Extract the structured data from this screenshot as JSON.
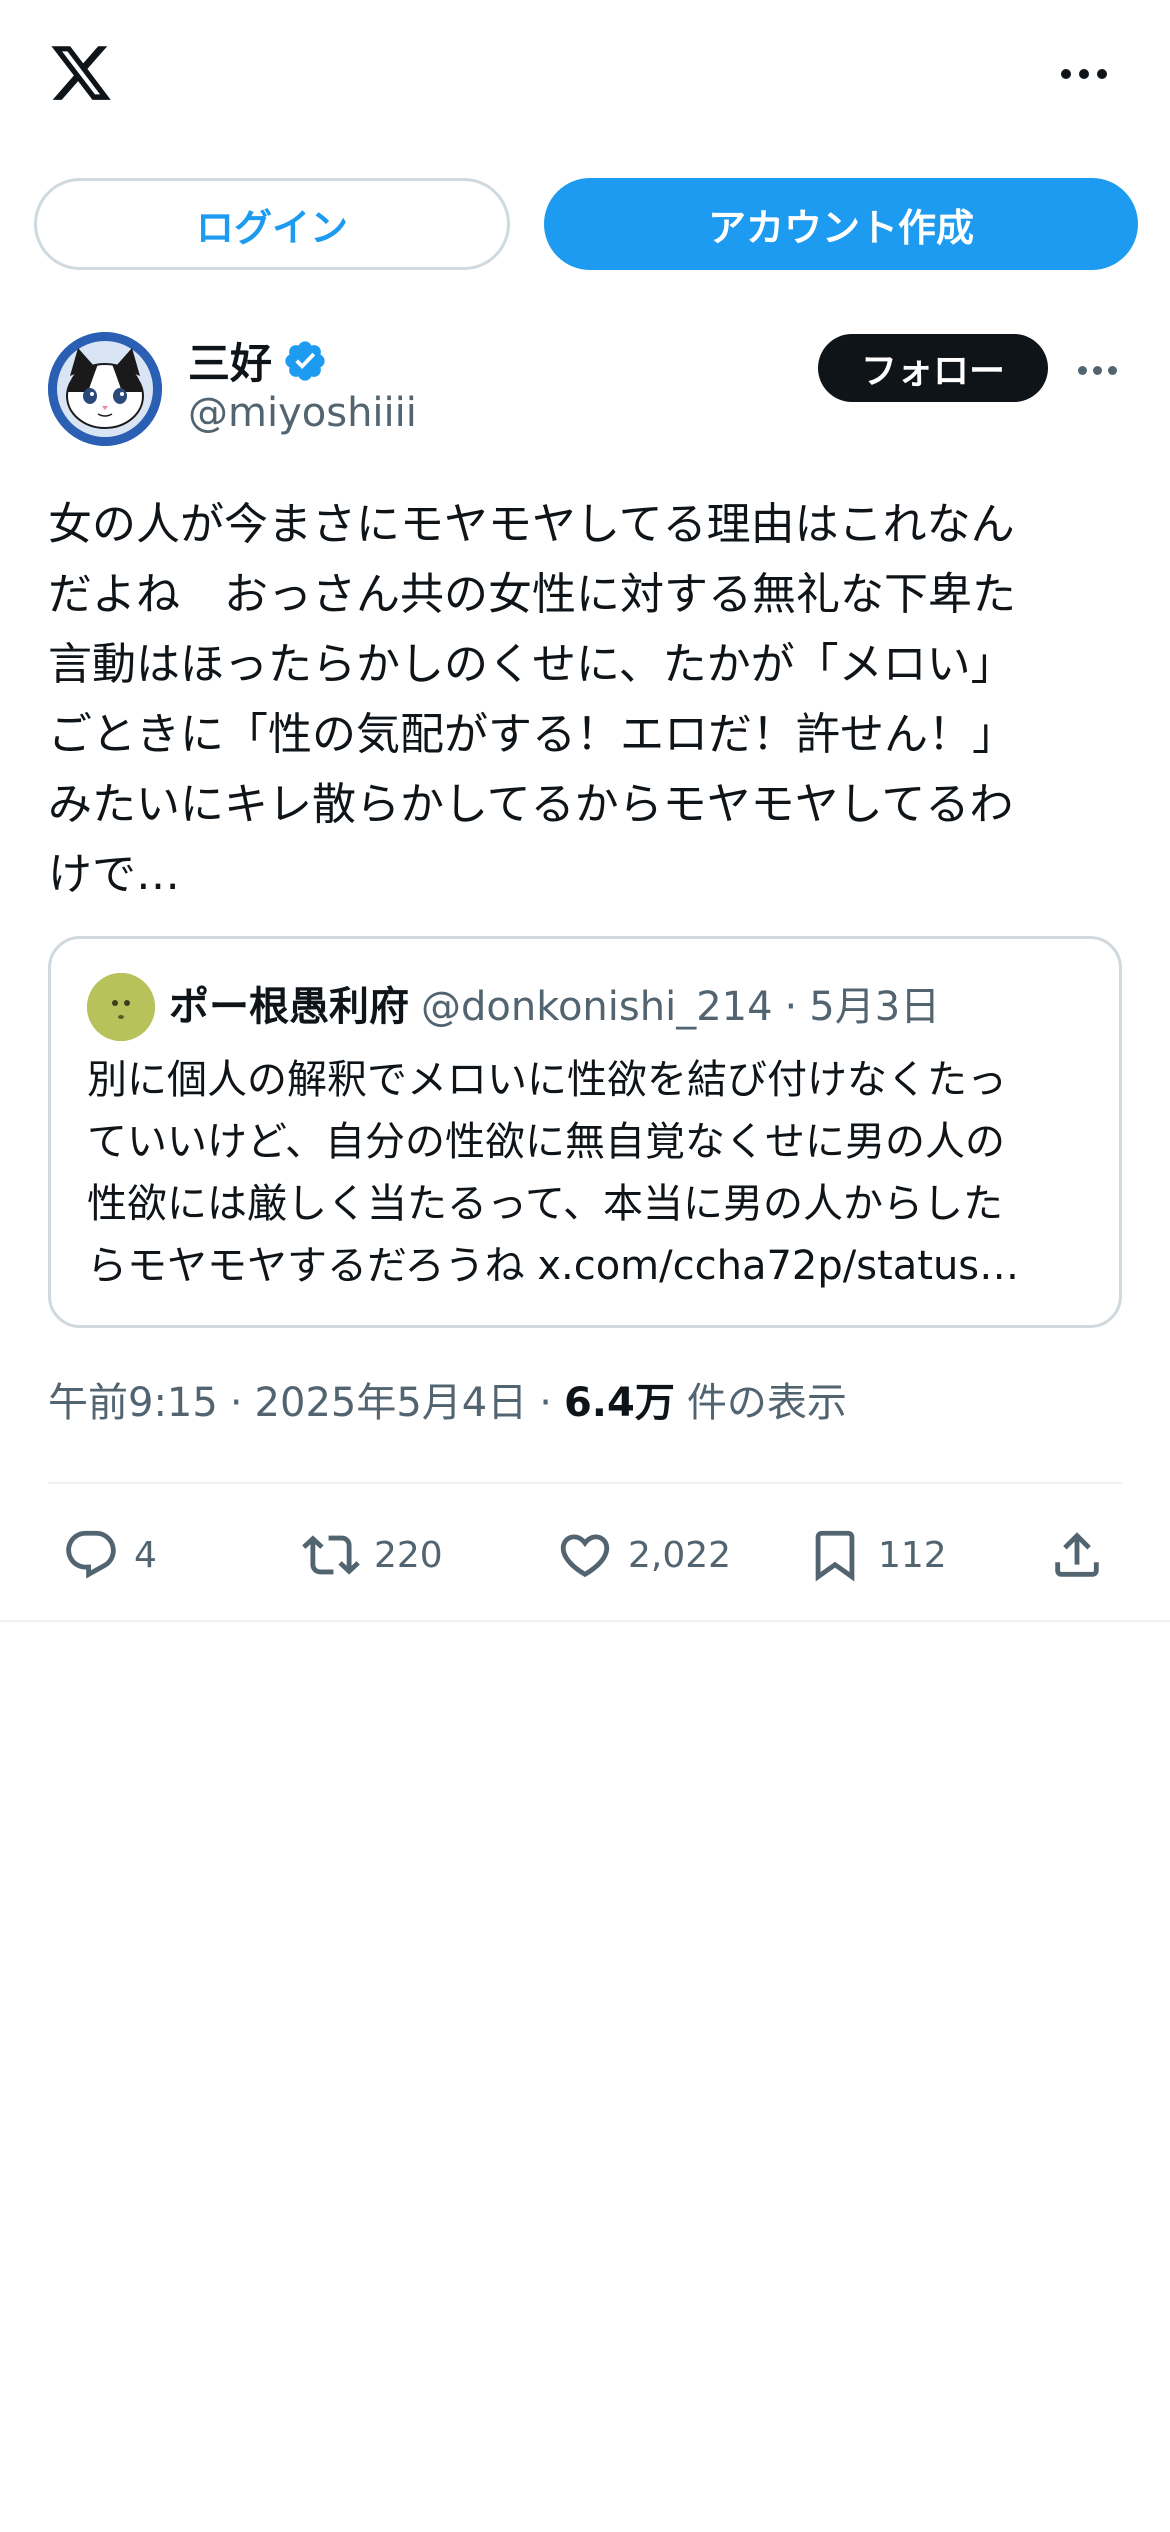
{
  "header": {
    "logo_icon": "x-logo-icon",
    "more_icon": "more-horizontal-icon"
  },
  "auth": {
    "login_label": "ログイン",
    "signup_label": "アカウント作成"
  },
  "author": {
    "display_name": "三好",
    "handle": "@miyoshiiii",
    "verified": true,
    "follow_label": "フォロー"
  },
  "tweet": {
    "text": "女の人が今まさにモヤモヤしてる理由はこれなん\nだよね　おっさん共の女性に対する無礼な下卑た\n言動はほったらかしのくせに、たかが「メロい」\nごときに「性の気配がする！エロだ！許せん！」\nみたいにキレ散らかしてるからモヤモヤしてるわ\nけで…"
  },
  "quote": {
    "display_name": "ポー根愚利府",
    "handle": "@donkonishi_214",
    "separator": "·",
    "date": "5月3日",
    "lines": [
      "別に個人の解釈でメロいに性欲を結び付けなくたっ",
      "ていいけど、自分の性欲に無自覚なくせに男の人の",
      "性欲には厳しく当たるって、本当に男の人からした",
      "らモヤモヤするだろうね x.com/ccha72p/status…"
    ]
  },
  "meta": {
    "time": "午前9:15",
    "sep1": "·",
    "date": "2025年5月4日",
    "sep2": "·",
    "views_count": "6.4万",
    "views_label": "件の表示"
  },
  "actions": {
    "reply_count": "4",
    "retweet_count": "220",
    "like_count": "2,022",
    "bookmark_count": "112"
  },
  "colors": {
    "accent": "#1d9bf0",
    "text": "#0f1419",
    "secondary": "#536471",
    "border": "#cfd9de"
  }
}
